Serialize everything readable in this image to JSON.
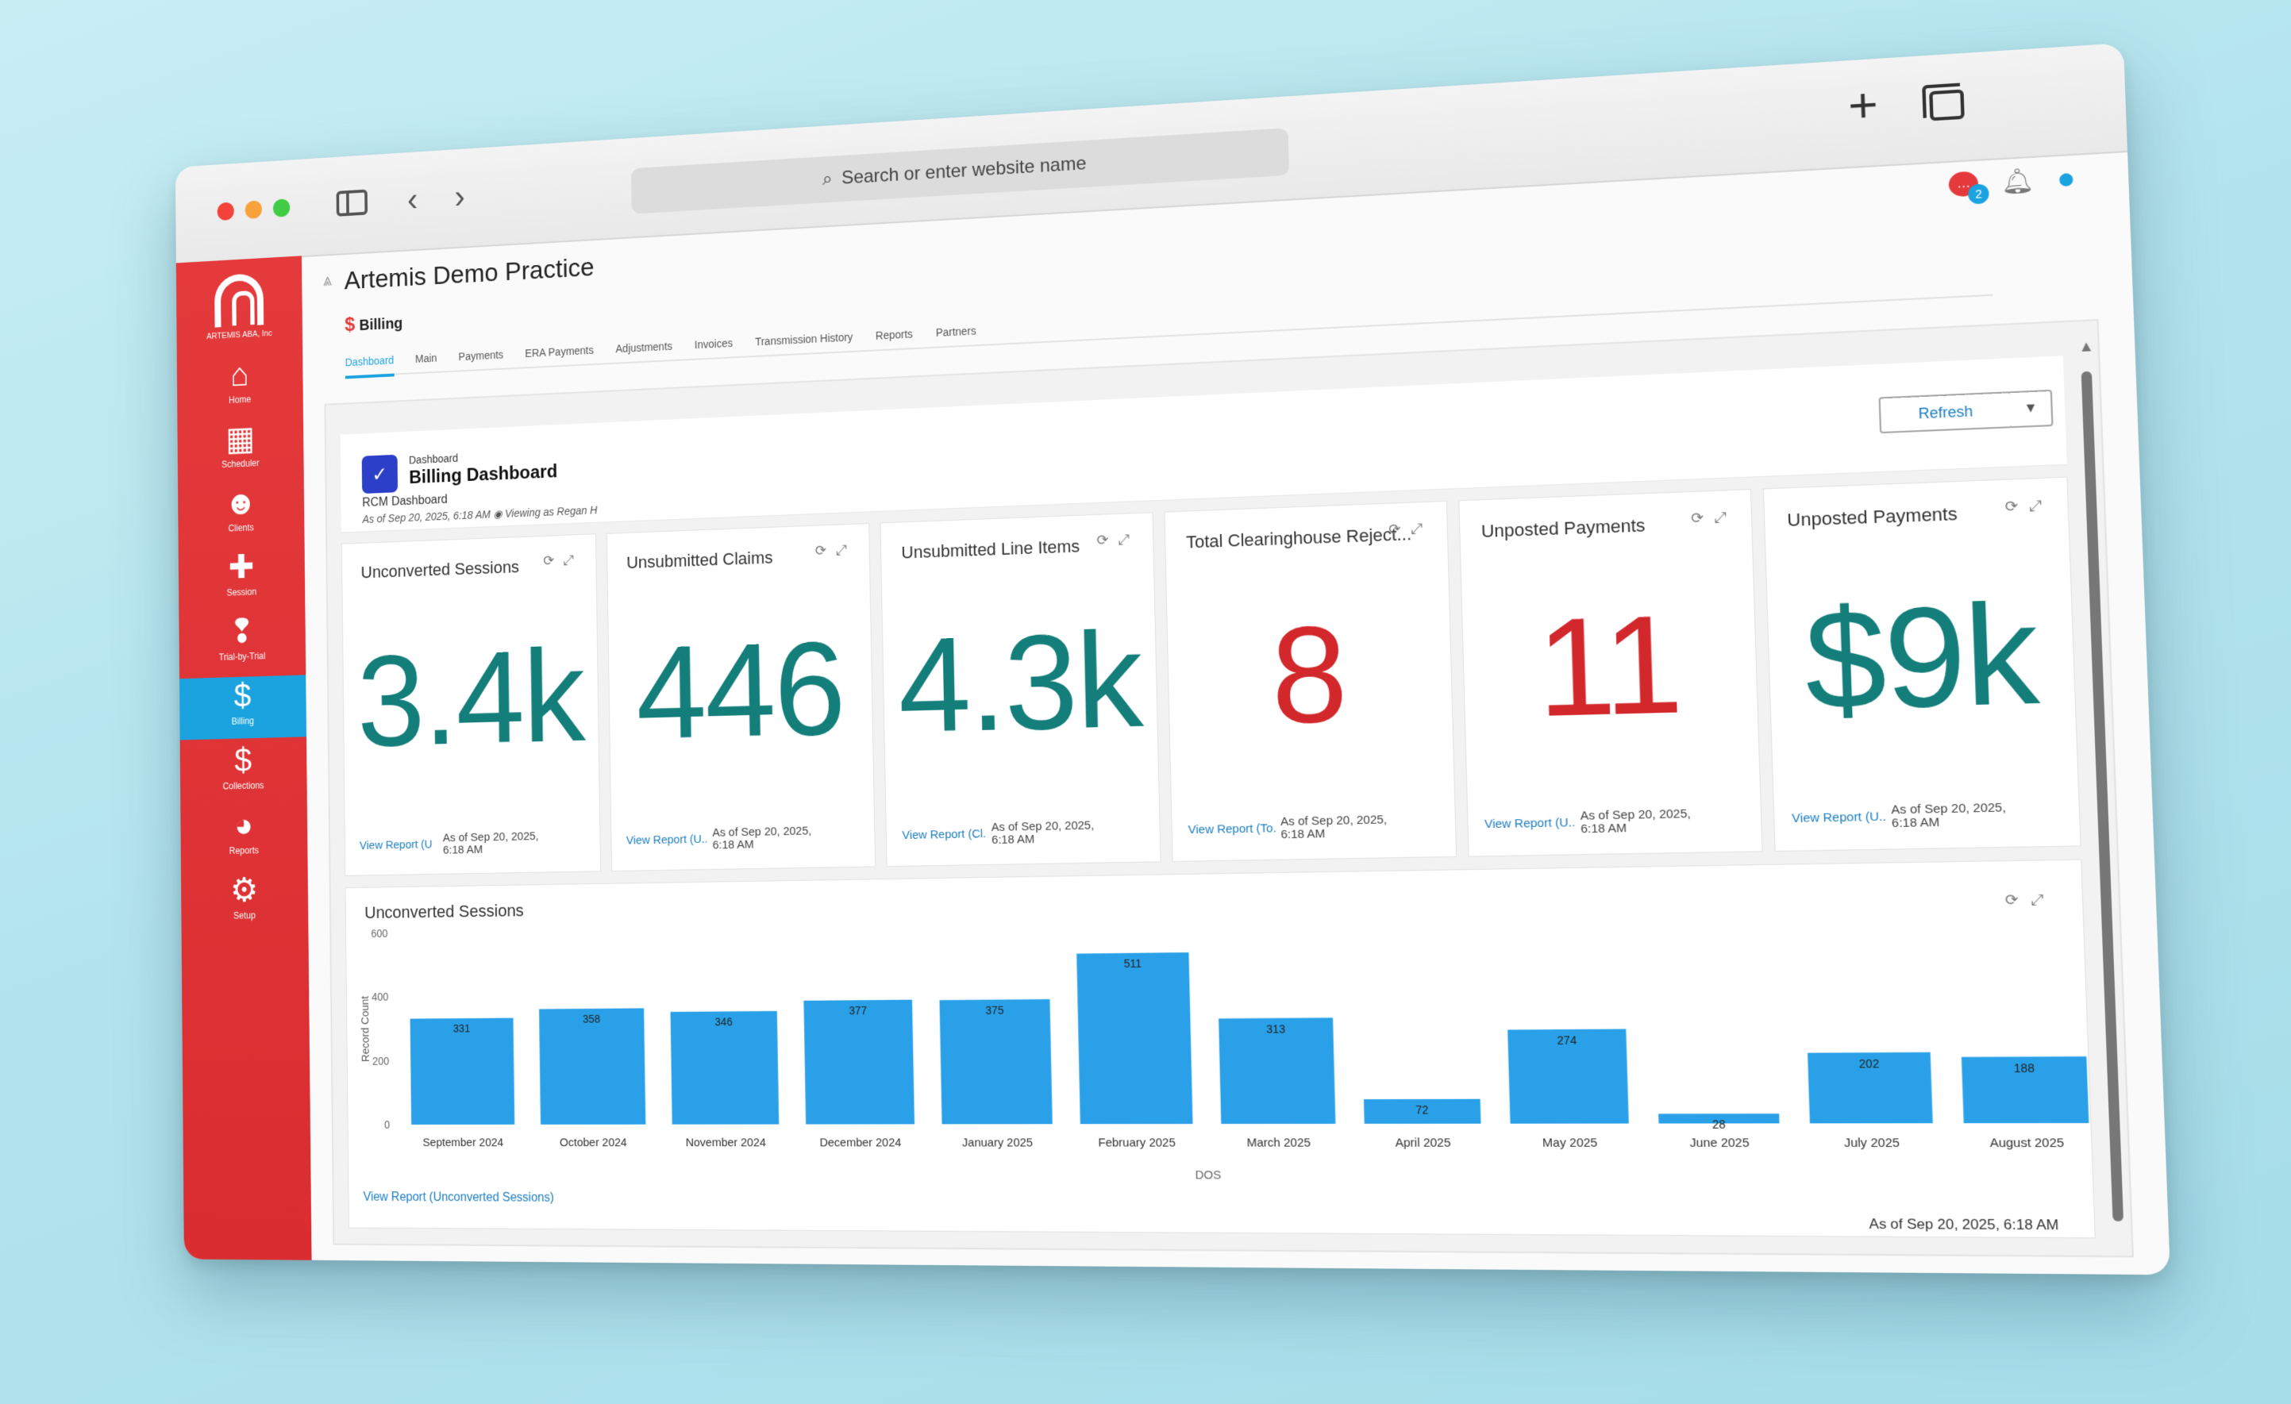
{
  "browser": {
    "url_placeholder": "Search or enter website name",
    "sidebar_toggle_icon": "sidebar-icon",
    "back_icon": "chevron-left-icon",
    "forward_icon": "chevron-right-icon",
    "new_tab_icon": "plus-icon",
    "tabs_icon": "tabs-icon"
  },
  "brand": {
    "company": "ARTEMIS ABA, Inc",
    "accent": "#e53a3c",
    "active": "#1ba3e0"
  },
  "sidebar": {
    "items": [
      {
        "label": "Home",
        "icon": "⌂"
      },
      {
        "label": "Scheduler",
        "icon": "▦"
      },
      {
        "label": "Clients",
        "icon": "☻"
      },
      {
        "label": "Session",
        "icon": "✚"
      },
      {
        "label": "Trial-by-Trial",
        "icon": "❢"
      },
      {
        "label": "Billing",
        "icon": "$"
      },
      {
        "label": "Collections",
        "icon": "$"
      },
      {
        "label": "Reports",
        "icon": "◕"
      },
      {
        "label": "Setup",
        "icon": "⚙"
      }
    ]
  },
  "header": {
    "practice": "Artemis Demo Practice",
    "chat_badge": "2"
  },
  "billing": {
    "title": "Billing",
    "tabs": [
      "Dashboard",
      "Main",
      "Payments",
      "ERA Payments",
      "Adjustments",
      "Invoices",
      "Transmission History",
      "Reports",
      "Partners"
    ]
  },
  "dashboard": {
    "breadcrumb": "Dashboard",
    "title": "Billing Dashboard",
    "subtitle": "RCM Dashboard",
    "as_of": "As of Sep 20, 2025, 6:18 AM",
    "viewing_as": "Viewing as Regan H",
    "refresh": "Refresh"
  },
  "cards": [
    {
      "title": "Unconverted Sessions",
      "value": "3.4k",
      "color": "teal",
      "link": "View Report (U",
      "as_of": "As of Sep 20, 2025, 6:18 AM"
    },
    {
      "title": "Unsubmitted Claims",
      "value": "446",
      "color": "teal",
      "link": "View Report (U...",
      "as_of": "As of Sep 20, 2025, 6:18 AM"
    },
    {
      "title": "Unsubmitted Line Items",
      "value": "4.3k",
      "color": "teal",
      "link": "View Report (Cl...",
      "as_of": "As of Sep 20, 2025, 6:18 AM"
    },
    {
      "title": "Total Clearinghouse Reject...",
      "value": "8",
      "color": "red",
      "link": "View Report (To...",
      "as_of": "As of Sep 20, 2025, 6:18 AM"
    },
    {
      "title": "Unposted Payments",
      "value": "11",
      "color": "red",
      "link": "View Report (U...",
      "as_of": "As of Sep 20, 2025, 6:18 AM"
    },
    {
      "title": "Unposted Payments",
      "value": "$9k",
      "color": "teal",
      "link": "View Report (U...",
      "as_of": "As of Sep 20, 2025, 6:18 AM"
    }
  ],
  "chart_panel": {
    "title": "Unconverted Sessions",
    "link": "View Report (Unconverted Sessions)",
    "as_of": "As of Sep 20, 2025, 6:18 AM"
  },
  "chart_data": {
    "type": "bar",
    "title": "Unconverted Sessions",
    "xlabel": "DOS",
    "ylabel": "Record Count",
    "ylim": [
      0,
      600
    ],
    "yticks": [
      0,
      200,
      400,
      600
    ],
    "bar_color": "#29a0e8",
    "categories": [
      "September 2024",
      "October 2024",
      "November 2024",
      "December 2024",
      "January 2025",
      "February 2025",
      "March 2025",
      "April 2025",
      "May 2025",
      "June 2025",
      "July 2025",
      "August 2025"
    ],
    "values": [
      331,
      358,
      346,
      377,
      375,
      511,
      313,
      72,
      274,
      28,
      202,
      188
    ]
  }
}
